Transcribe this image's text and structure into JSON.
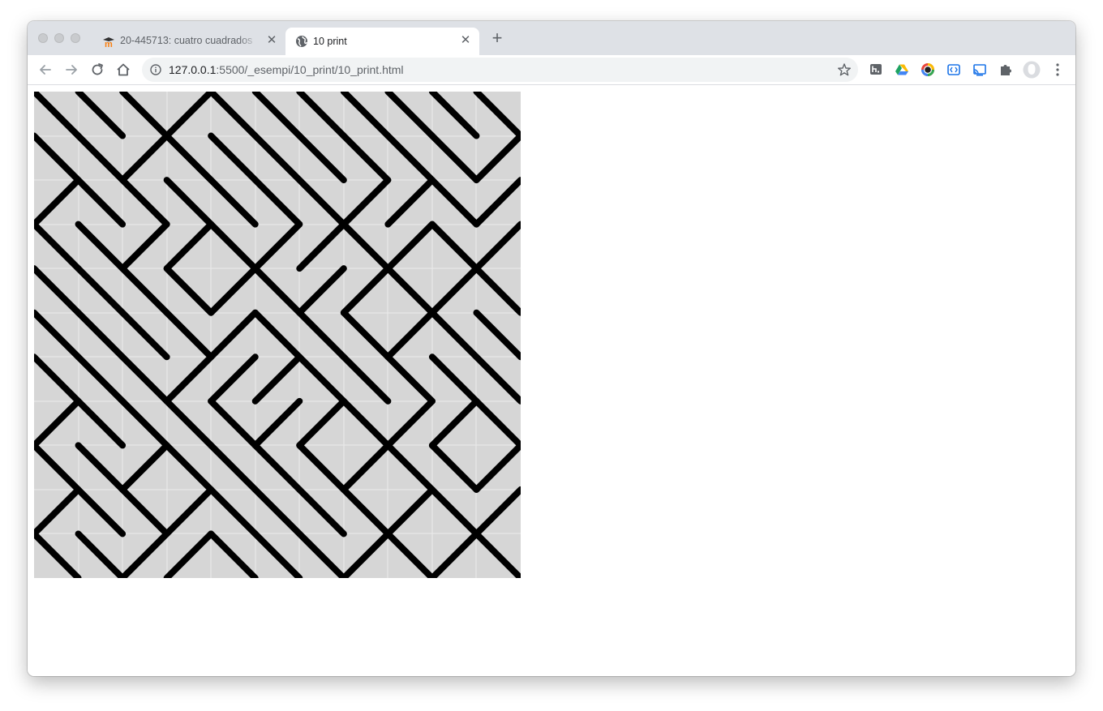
{
  "browser": {
    "tabs": [
      {
        "title": "20-445713: cuatro cuadrados",
        "active": false
      },
      {
        "title": "10 print",
        "active": true
      }
    ],
    "url_host": "127.0.0.1",
    "url_path": ":5500/_esempi/10_print/10_print.html",
    "icons": {
      "back": "arrow-left-icon",
      "forward": "arrow-right-icon",
      "reload": "reload-icon",
      "home": "home-icon",
      "info": "info-icon",
      "bookmark": "star-icon",
      "extensions": [
        "hypothesis-icon",
        "google-drive-icon",
        "color-picker-icon",
        "devtools-extension-icon",
        "cast-icon",
        "puzzle-icon"
      ],
      "profile": "avatar-icon",
      "menu": "kebab-menu-icon"
    }
  },
  "canvas": {
    "grid_size": 11,
    "background": "#d6d6d6",
    "gridline_color": "#ececec",
    "stroke_color": "#000000",
    "pattern": [
      "\\\\\\/\\\\\\\\\\\\\\",
      "\\\\/\\\\\\\\\\\\\\/",
      "/\\\\\\\\\\\\//\\/",
      "\\\\//\\//\\/\\/",
      "\\\\\\\\/\\//\\/\\",
      "\\\\\\\\/\\\\\\/\\\\",
      "\\\\\\///\\\\\\\\\\",
      "/\\\\\\\\//\\//\\",
      "\\\\/\\\\\\\\/\\\\/",
      "/\\\\/\\\\\\\\/\\/",
      "\\\\//\\\\\\/\\/\\"
    ]
  }
}
